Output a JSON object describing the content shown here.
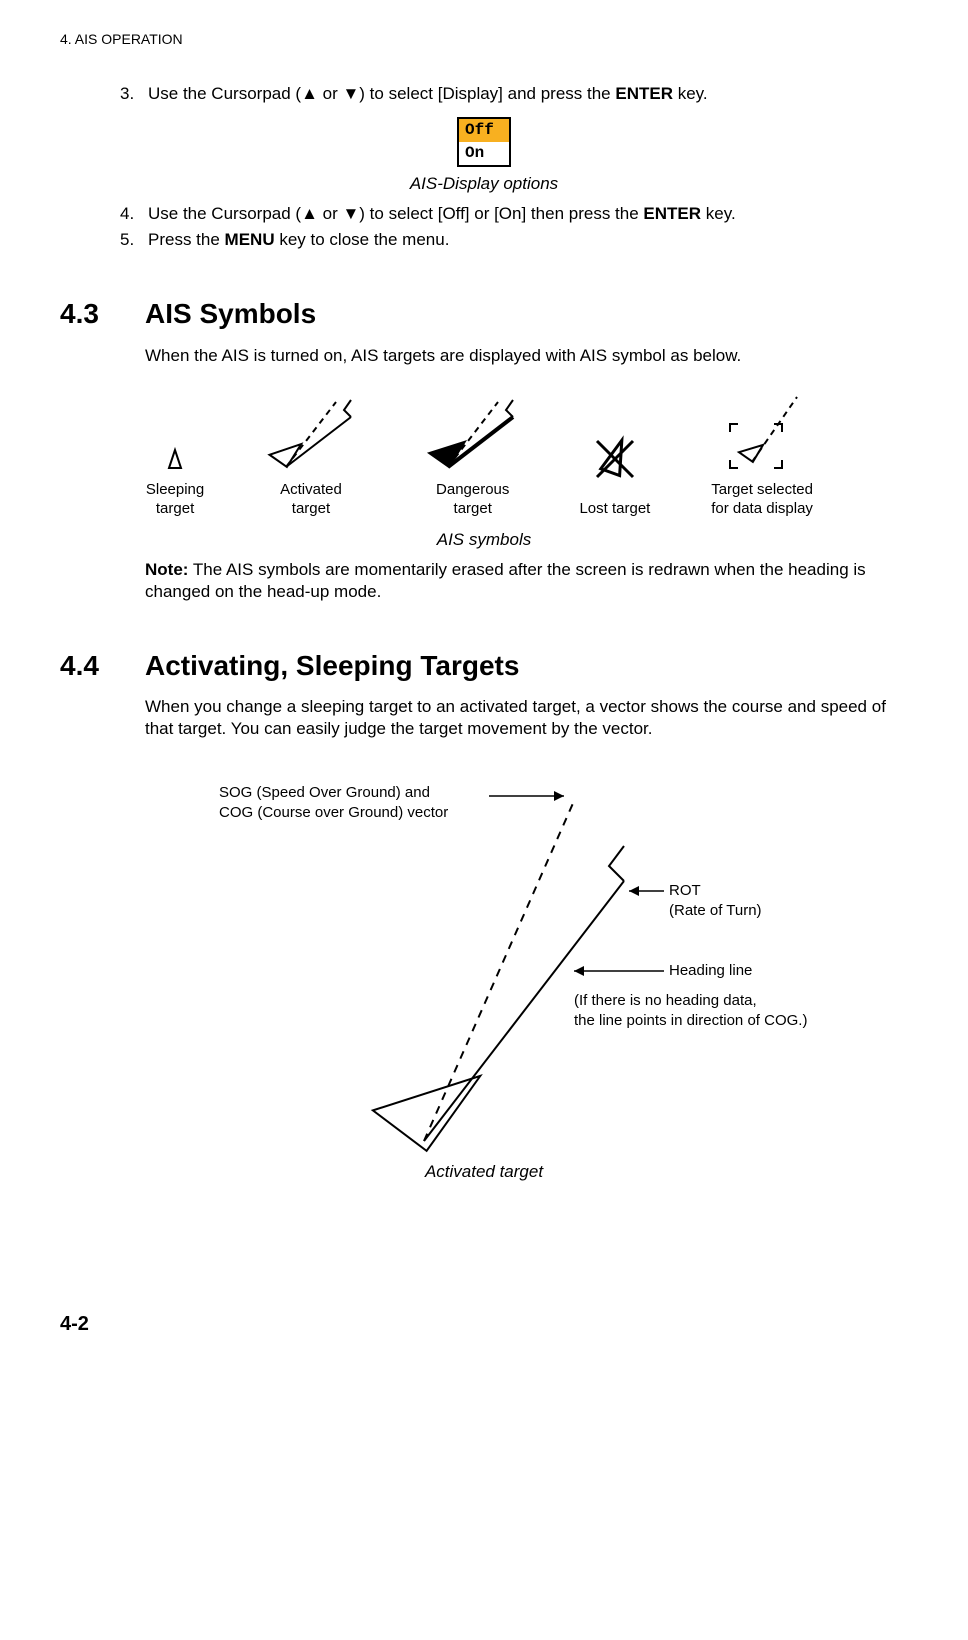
{
  "header": "4.  AIS OPERATION",
  "steps": {
    "s3_num": "3.",
    "s3_text_a": "Use the Cursorpad (",
    "s3_text_b": " or ",
    "s3_text_c": ") to select [Display] and press the ",
    "s3_key": "ENTER",
    "s3_text_d": " key.",
    "opt_off": "Off",
    "opt_on": "On",
    "fig1_caption": "AIS-Display options",
    "s4_num": "4.",
    "s4_text_a": "Use the Cursorpad (",
    "s4_text_b": " or ",
    "s4_text_c": ") to select [Off] or [On] then press the ",
    "s4_key": "ENTER",
    "s4_text_d": " key.",
    "s5_num": "5.",
    "s5_text_a": "Press the ",
    "s5_key": "MENU",
    "s5_text_b": " key to close the menu."
  },
  "sec43": {
    "num": "4.3",
    "title": "AIS Symbols",
    "body": "When the AIS is turned on, AIS targets are displayed with AIS symbol as below.",
    "labels": {
      "sleeping": "Sleeping\ntarget",
      "activated": "Activated\ntarget",
      "dangerous": "Dangerous\ntarget",
      "lost": "Lost target",
      "selected": "Target selected\nfor data display"
    },
    "fig_caption": "AIS symbols",
    "note_label": "Note:",
    "note_text": " The AIS symbols are momentarily erased after the screen is redrawn when the heading is changed on the head-up mode."
  },
  "sec44": {
    "num": "4.4",
    "title": "Activating, Sleeping Targets",
    "body": "When you change a sleeping target to an activated target, a vector shows the course and speed of that target. You can easily judge the target movement by the vector.",
    "labels": {
      "sog": "SOG (Speed Over Ground) and\nCOG (Course over Ground) vector",
      "rot": "ROT\n(Rate of Turn)",
      "heading": "Heading line",
      "cog_note": "(If there is no heading data,\nthe line points in direction of COG.)"
    },
    "fig_caption": "Activated target"
  },
  "page_num": "4-2"
}
